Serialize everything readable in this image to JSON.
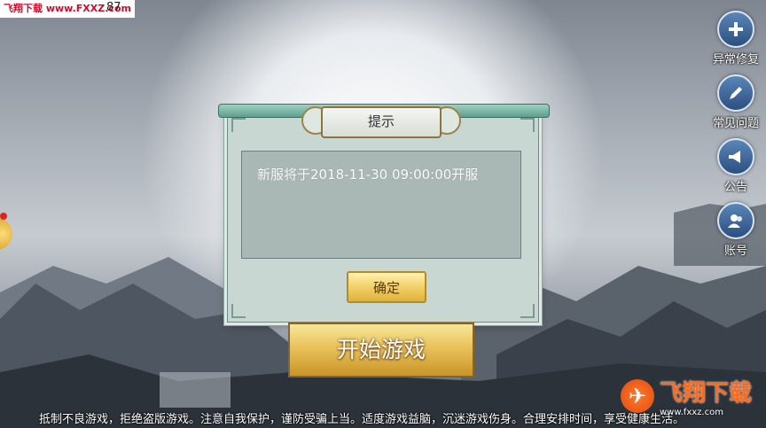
{
  "status": {
    "watermark": "飞翔下载 www.FXXZ.com",
    "fps": "87"
  },
  "side_menu": [
    {
      "label": "异常修复",
      "icon": "repair-plus-icon"
    },
    {
      "label": "常见问题",
      "icon": "pencil-icon"
    },
    {
      "label": "公告",
      "icon": "megaphone-icon"
    },
    {
      "label": "账号",
      "icon": "account-icon"
    }
  ],
  "dialog": {
    "title": "提示",
    "message": "新服将于2018-11-30 09:00:00开服",
    "confirm_label": "确定"
  },
  "start_button": "开始游戏",
  "notice": "抵制不良游戏，拒绝盗版游戏。注意自我保护，谨防受骗上当。适度游戏益脑，沉迷游戏伤身。合理安排时间，享受健康生活。",
  "bottom_watermark": {
    "title": "飞翔下载",
    "url": "www.fxxz.com"
  },
  "colors": {
    "accent_gold": "#e0b13b",
    "dialog_bg": "#c9d7d3",
    "side_button": "#2b4f80",
    "watermark_red": "#c8102e"
  }
}
